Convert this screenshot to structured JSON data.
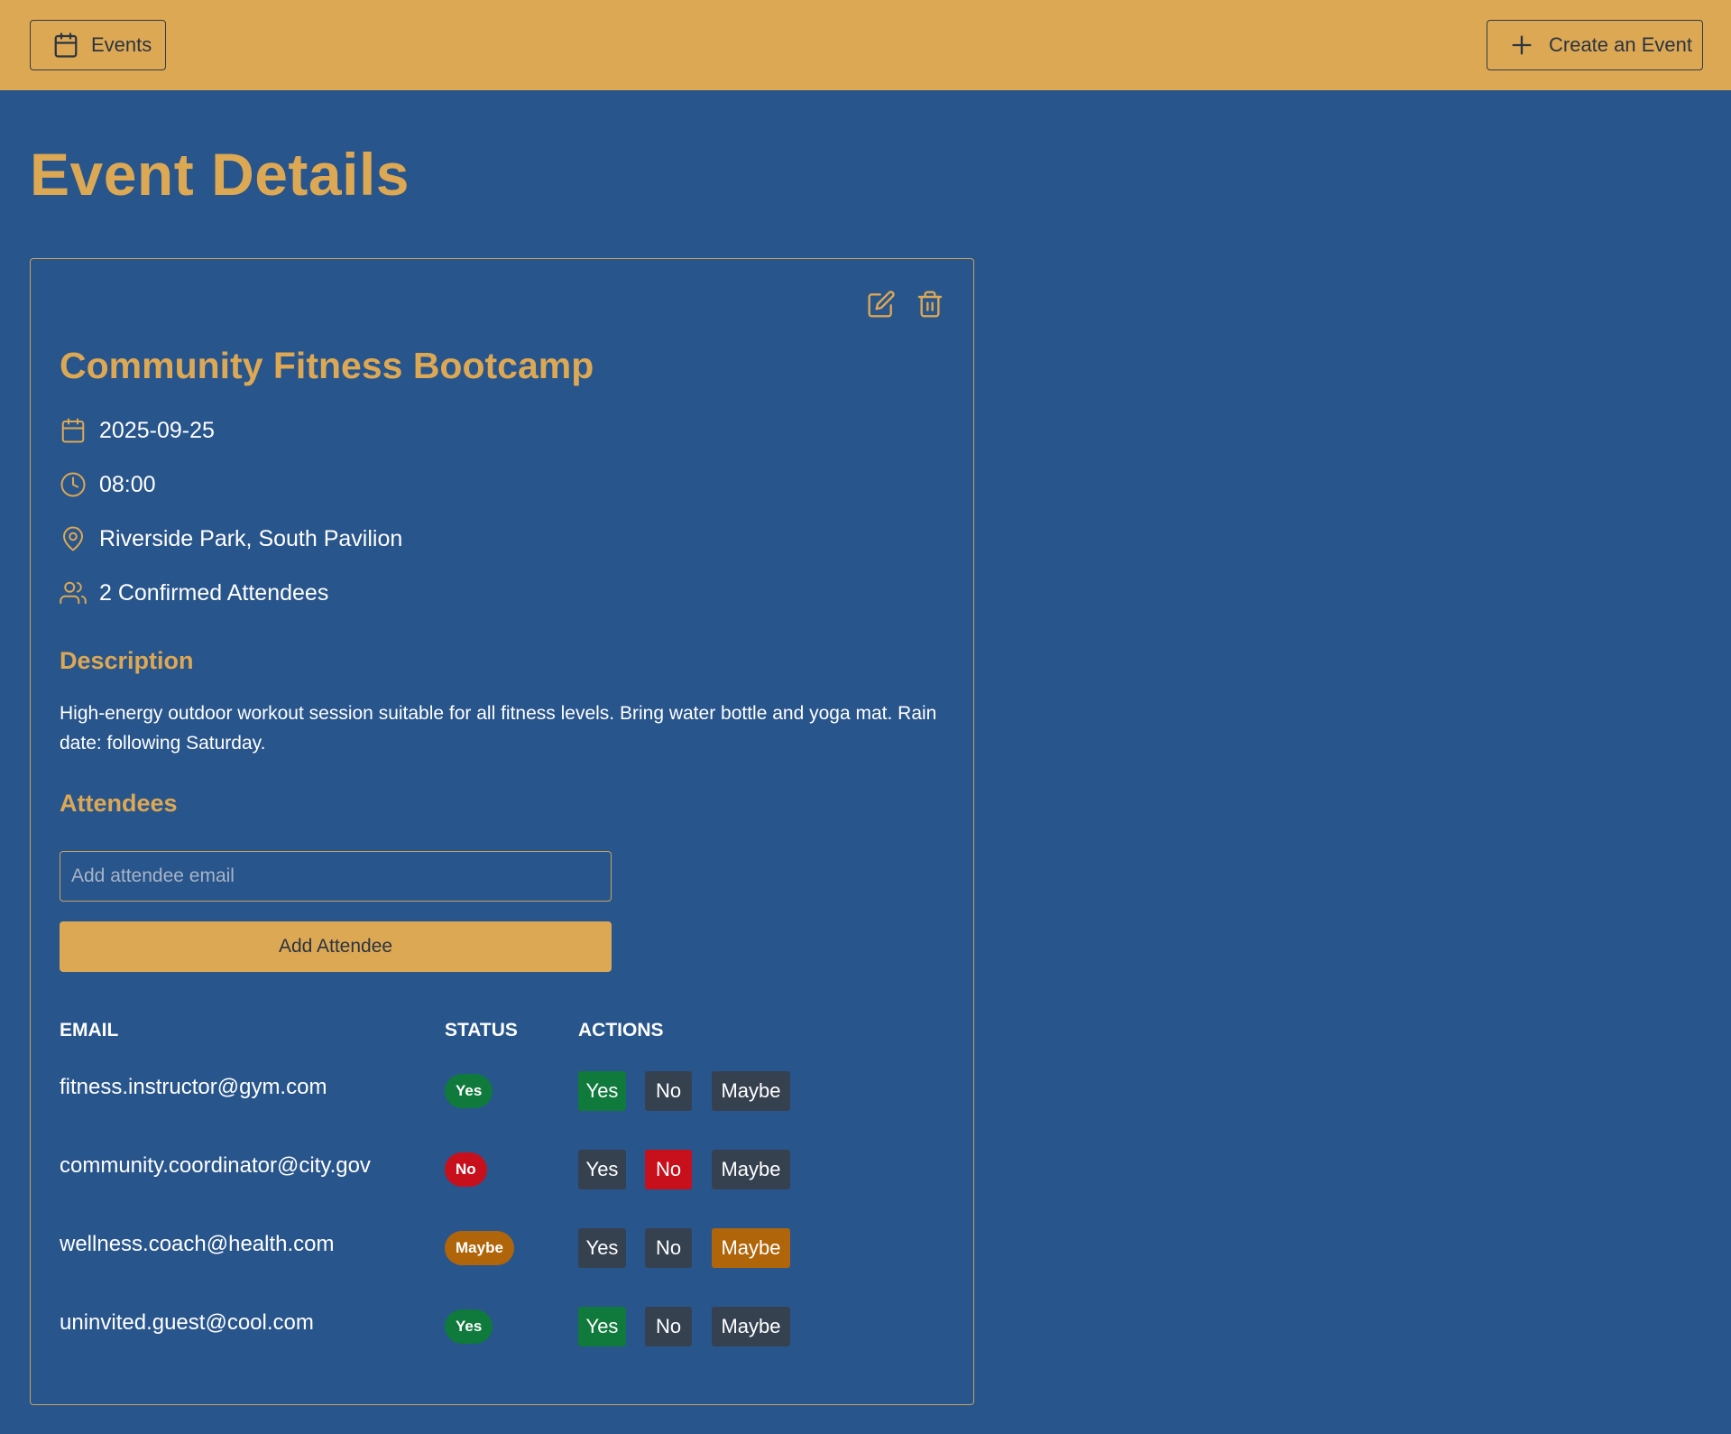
{
  "header": {
    "events_label": "Events",
    "create_label": "Create an Event"
  },
  "page": {
    "title": "Event Details"
  },
  "event": {
    "title": "Community Fitness Bootcamp",
    "date": "2025-09-25",
    "time": "08:00",
    "location": "Riverside Park, South Pavilion",
    "attendee_count": "2 Confirmed Attendees",
    "description_heading": "Description",
    "description": "High-energy outdoor workout session suitable for all fitness levels. Bring water bottle and yoga mat. Rain date: following Saturday."
  },
  "attendees": {
    "heading": "Attendees",
    "email_placeholder": "Add attendee email",
    "email_value": "",
    "add_label": "Add Attendee",
    "columns": [
      "EMAIL",
      "STATUS",
      "ACTIONS"
    ],
    "actions": [
      "Yes",
      "No",
      "Maybe"
    ],
    "rows": [
      {
        "email": "fitness.instructor@gym.com",
        "status": "Yes"
      },
      {
        "email": "community.coordinator@city.gov",
        "status": "No"
      },
      {
        "email": "wellness.coach@health.com",
        "status": "Maybe"
      },
      {
        "email": "uninvited.guest@cool.com",
        "status": "Yes"
      }
    ]
  },
  "colors": {
    "background": "#28558c",
    "accent": "#dda853",
    "yes": "#0f7a3c",
    "no": "#c8101d",
    "maybe": "#b0650a",
    "inactive": "#364150"
  },
  "icons": [
    "calendar-icon",
    "plus-icon",
    "edit-icon",
    "trash-icon",
    "clock-icon",
    "map-pin-icon",
    "users-icon"
  ]
}
